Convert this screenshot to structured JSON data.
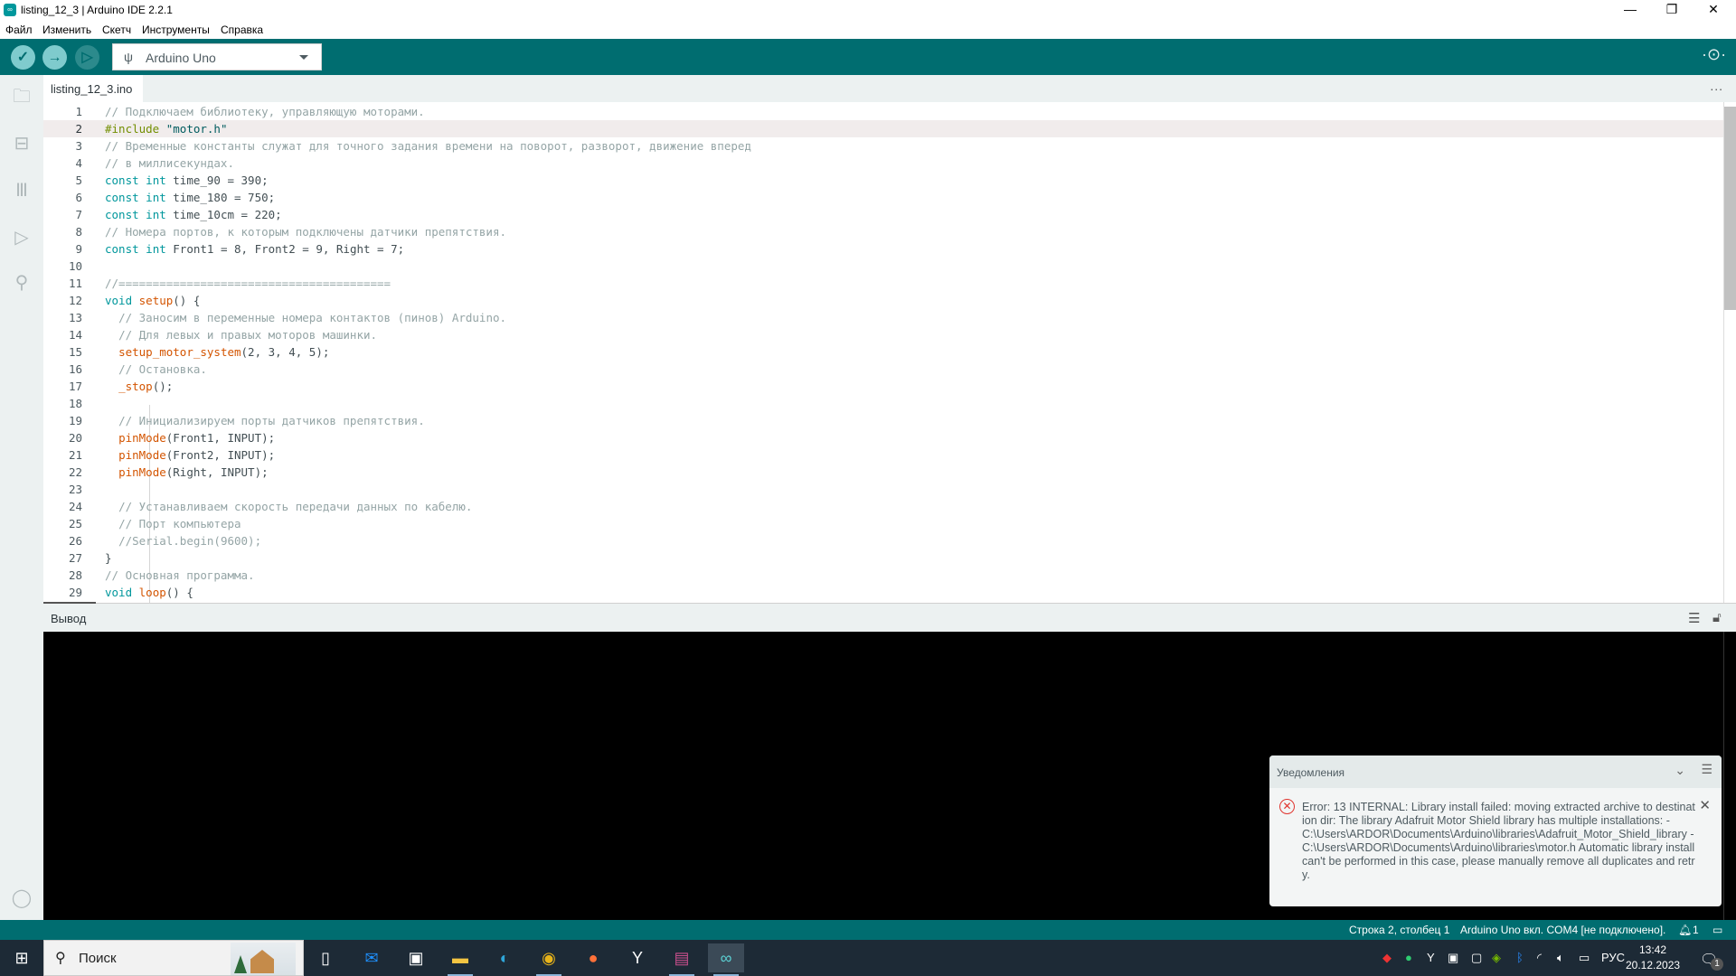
{
  "window": {
    "title": "listing_12_3 | Arduino IDE 2.2.1",
    "app_icon": "arduino-logo-icon",
    "controls": [
      "minimize",
      "restore",
      "close"
    ]
  },
  "menu": [
    "Файл",
    "Изменить",
    "Скетч",
    "Инструменты",
    "Справка"
  ],
  "toolbar": {
    "verify": "verify-icon",
    "upload": "upload-icon",
    "debug": "debug-icon",
    "board_selector": {
      "usb_icon": "usb-icon",
      "value": "Arduino Uno"
    },
    "serial_plotter": "serial-plotter-icon",
    "serial_monitor": "serial-monitor-icon"
  },
  "sidebar": {
    "items": [
      {
        "name": "sketchbook",
        "icon": "folder-icon"
      },
      {
        "name": "boards-manager",
        "icon": "board-icon"
      },
      {
        "name": "library-manager",
        "icon": "library-icon"
      },
      {
        "name": "debug",
        "icon": "debug-icon"
      },
      {
        "name": "search",
        "icon": "search-icon"
      }
    ],
    "account_icon": "account-icon"
  },
  "editor": {
    "tab": "listing_12_3.ino",
    "more": "...",
    "current_line": 2,
    "lines": [
      "// Подключаем библиотеку, управляющую моторами.",
      "#include \"motor.h\"",
      "// Временные константы служат для точного задания времени на поворот, разворот, движение вперед",
      "// в миллисекундах.",
      "const int time_90 = 390;",
      "const int time_180 = 750;",
      "const int time_10cm = 220;",
      "// Номера портов, к которым подключены датчики препятствия.",
      "const int Front1 = 8, Front2 = 9, Right = 7;",
      "",
      "//========================================",
      "void setup() {",
      "  // Заносим в переменные номера контактов (пинов) Arduino.",
      "  // Для левых и правых моторов машинки.",
      "  setup_motor_system(2, 3, 4, 5);",
      "  // Остановка.",
      "  _stop();",
      "",
      "  // Инициализируем порты датчиков препятствия.",
      "  pinMode(Front1, INPUT);",
      "  pinMode(Front2, INPUT);",
      "  pinMode(Right, INPUT);",
      "",
      "  // Устанавливаем скорость передачи данных по кабелю.",
      "  // Порт компьютера",
      "  //Serial.begin(9600);",
      "}",
      "// Основная программа.",
      "void loop() {"
    ]
  },
  "output": {
    "label": "Вывод",
    "clear_icon": "clear-output-icon",
    "lock_icon": "scroll-lock-icon"
  },
  "notification": {
    "header": "Уведомления",
    "message": "Error: 13 INTERNAL: Library install failed: moving extracted archive to destination dir: The library Adafruit Motor Shield library has multiple installations: - C:\\Users\\ARDOR\\Documents\\Arduino\\libraries\\Adafruit_Motor_Shield_library - C:\\Users\\ARDOR\\Documents\\Arduino\\libraries\\motor.h Automatic library install can't be performed in this case, please manually remove all duplicates and retry.",
    "severity_color": "#e0332d"
  },
  "status": {
    "position": "Строка 2, столбец 1",
    "board": "Arduino Uno вкл. COM4 [не подключено].",
    "notifications_count": "1"
  },
  "taskbar": {
    "search_placeholder": "Поиск",
    "apps": [
      "task-view",
      "mail",
      "store",
      "file-explorer",
      "edge",
      "chrome",
      "firefox",
      "yandex-browser",
      "winrar",
      "arduino-ide"
    ],
    "tray": {
      "language": "РУС",
      "time": "13:42",
      "date": "20.12.2023",
      "notification_badge": "1"
    }
  },
  "colors": {
    "accent": "#006d70",
    "sidebar_bg": "#ecf1f1",
    "comment": "#95a5a6",
    "keyword": "#00979c",
    "function": "#d35400",
    "preprocessor": "#728e00"
  }
}
